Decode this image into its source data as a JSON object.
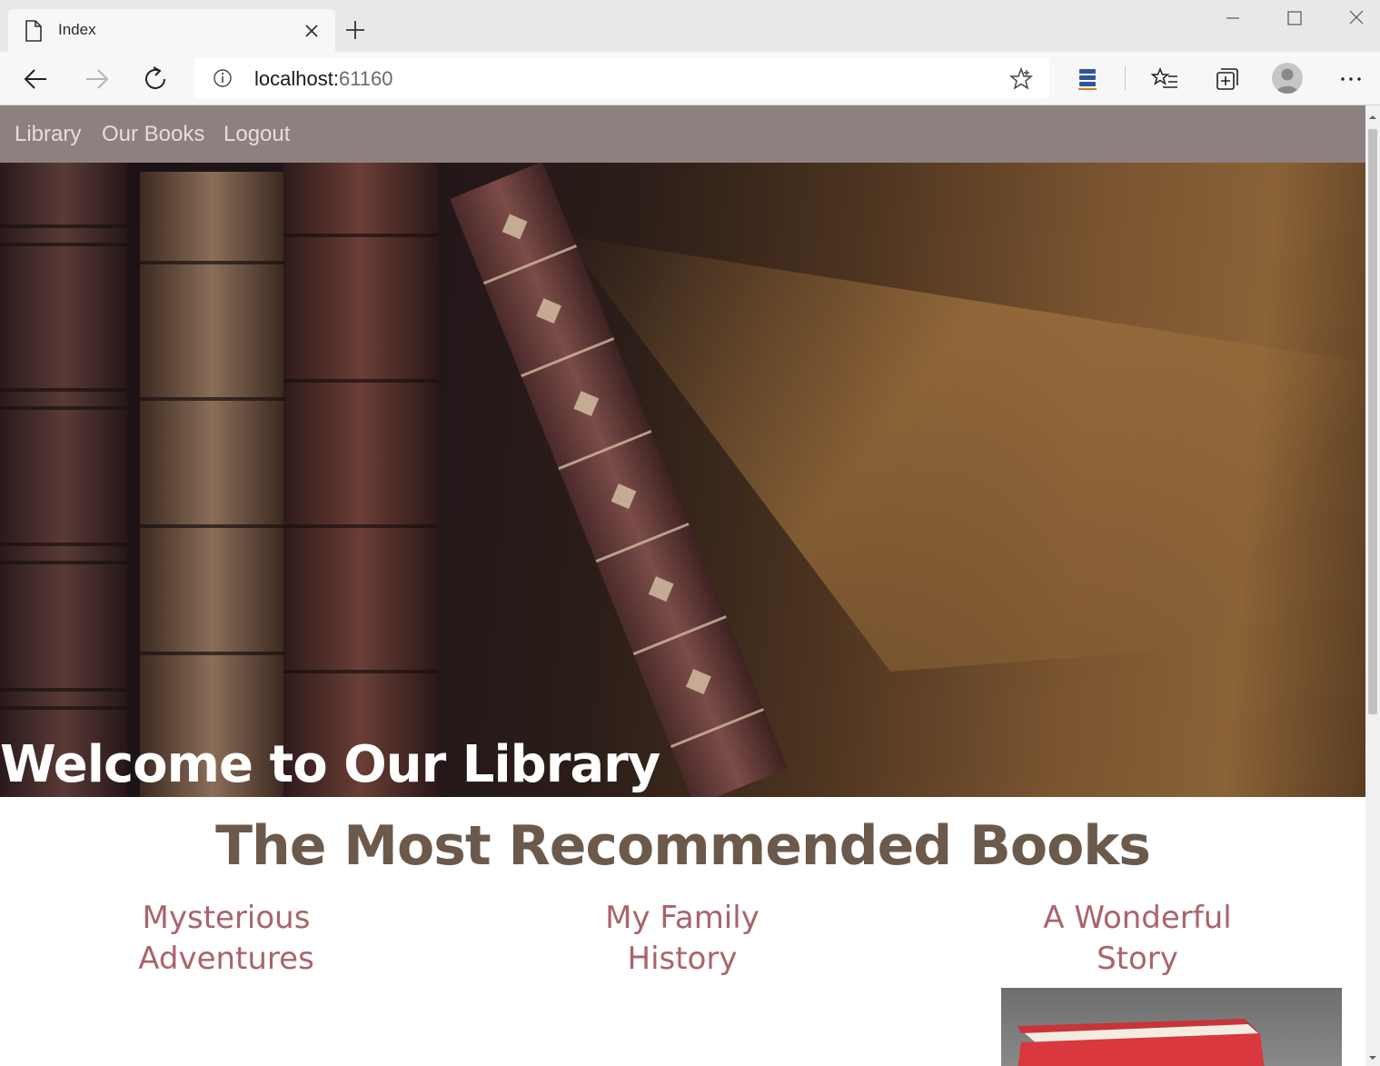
{
  "browser": {
    "tab_title": "Index",
    "address_host": "localhost:",
    "address_port": "61160"
  },
  "nav": {
    "items": [
      {
        "label": "Library"
      },
      {
        "label": "Our Books"
      },
      {
        "label": "Logout"
      }
    ]
  },
  "hero": {
    "title": "Welcome to Our Library"
  },
  "recommended": {
    "title": "The Most Recommended Books",
    "books": [
      {
        "title_line1": "Mysterious",
        "title_line2": "Adventures"
      },
      {
        "title_line1": "My Family",
        "title_line2": "History"
      },
      {
        "title_line1": "A Wonderful",
        "title_line2": "Story"
      }
    ]
  },
  "colors": {
    "nav_bg": "#8f8080",
    "nav_text": "#e6dcdc",
    "heading": "#6b5a4b",
    "book_title": "#a9646a"
  }
}
